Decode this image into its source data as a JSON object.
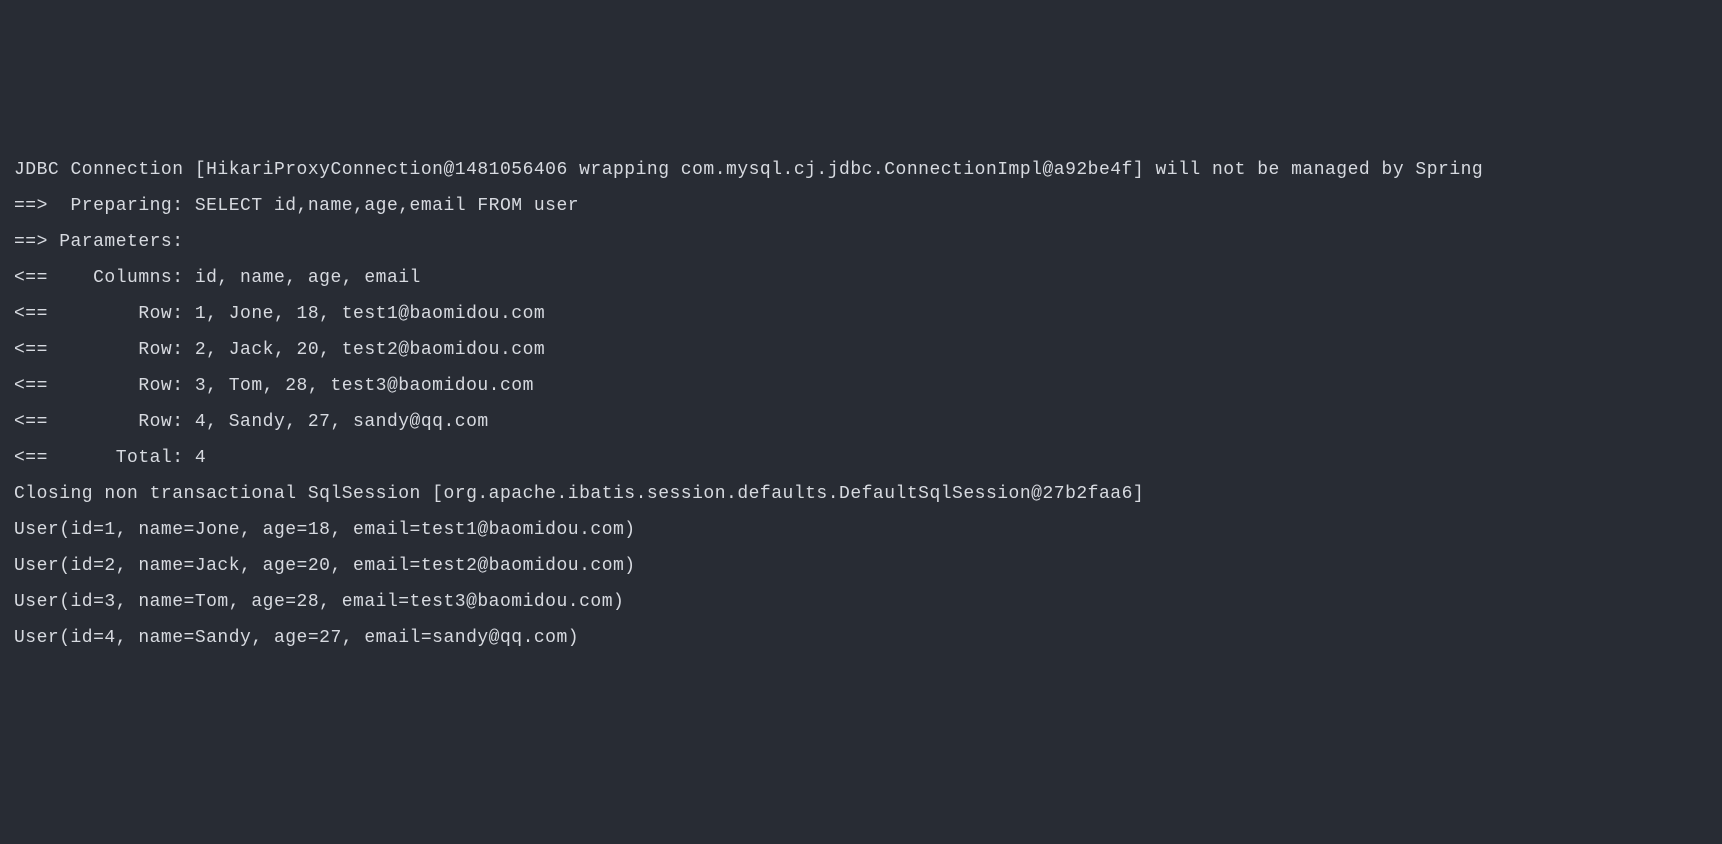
{
  "lines": {
    "l0": "JDBC Connection [HikariProxyConnection@1481056406 wrapping com.mysql.cj.jdbc.ConnectionImpl@a92be4f] will not be managed by Spring",
    "l1": "==>  Preparing: SELECT id,name,age,email FROM user ",
    "l2": "==> Parameters: ",
    "l3": "<==    Columns: id, name, age, email",
    "l4": "<==        Row: 1, Jone, 18, test1@baomidou.com",
    "l5": "<==        Row: 2, Jack, 20, test2@baomidou.com",
    "l6": "<==        Row: 3, Tom, 28, test3@baomidou.com",
    "l7": "<==        Row: 4, Sandy, 27, sandy@qq.com",
    "l8": "<==      Total: 4",
    "l9": "Closing non transactional SqlSession [org.apache.ibatis.session.defaults.DefaultSqlSession@27b2faa6]",
    "l10": "User(id=1, name=Jone, age=18, email=test1@baomidou.com)",
    "l11": "User(id=2, name=Jack, age=20, email=test2@baomidou.com)",
    "l12": "User(id=3, name=Tom, age=28, email=test3@baomidou.com)",
    "l13": "User(id=4, name=Sandy, age=27, email=sandy@qq.com)"
  }
}
